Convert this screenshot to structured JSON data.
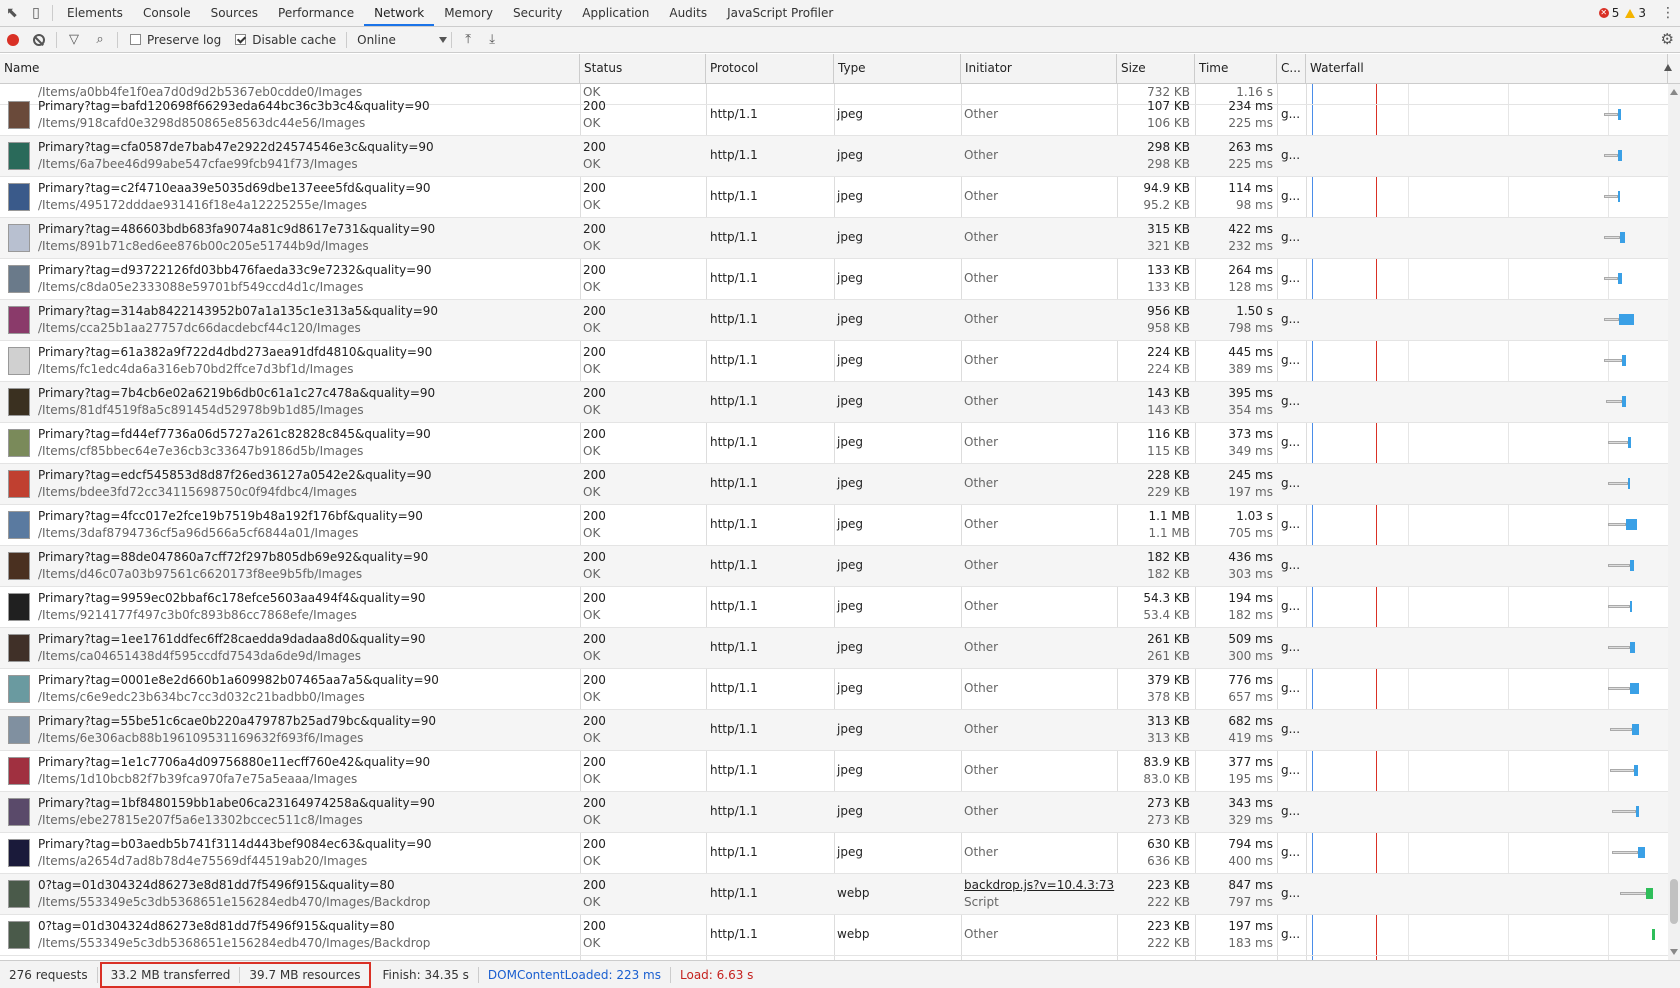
{
  "tabbar": {
    "tabs": [
      "Elements",
      "Console",
      "Sources",
      "Performance",
      "Network",
      "Memory",
      "Security",
      "Application",
      "Audits",
      "JavaScript Profiler"
    ],
    "active": "Network",
    "errors": "5",
    "warnings": "3"
  },
  "toolbar": {
    "preserve_log": "Preserve log",
    "disable_cache": "Disable cache",
    "throttle": "Online"
  },
  "columns": [
    "Name",
    "Status",
    "Protocol",
    "Type",
    "Initiator",
    "Size",
    "Time",
    "C...",
    "Waterfall"
  ],
  "top_partial": {
    "name": "/Items/a0bb4fe1f0ea7d0d9d2b5367eb0cdde0/Images",
    "status": "OK",
    "size": "732 KB",
    "time": "1.16 s"
  },
  "rows": [
    {
      "name": "Primary?tag=bafd120698f66293eda644bc36c3b3c4&quality=90",
      "path": "/Items/918cafd0e3298d850865e8563dc44e56/Images",
      "status": "200",
      "status_text": "OK",
      "protocol": "http/1.1",
      "type": "jpeg",
      "initiator": "Other",
      "size": "107 KB",
      "resource": "106 KB",
      "time": "234 ms",
      "latency": "225 ms",
      "cache": "g...",
      "thumb": "#6a4a3a"
    },
    {
      "name": "Primary?tag=cfa0587de7bab47e2922d24574546e3c&quality=90",
      "path": "/Items/6a7bee46d99abe547cfae99fcb941f73/Images",
      "status": "200",
      "status_text": "OK",
      "protocol": "http/1.1",
      "type": "jpeg",
      "initiator": "Other",
      "size": "298 KB",
      "resource": "298 KB",
      "time": "263 ms",
      "latency": "225 ms",
      "cache": "g...",
      "thumb": "#2a6a5a"
    },
    {
      "name": "Primary?tag=c2f4710eaa39e5035d69dbe137eee5fd&quality=90",
      "path": "/Items/495172dddae931416f18e4a12225255e/Images",
      "status": "200",
      "status_text": "OK",
      "protocol": "http/1.1",
      "type": "jpeg",
      "initiator": "Other",
      "size": "94.9 KB",
      "resource": "95.2 KB",
      "time": "114 ms",
      "latency": "98 ms",
      "cache": "g...",
      "thumb": "#3a5a8a"
    },
    {
      "name": "Primary?tag=486603bdb683fa9074a81c9d8617e731&quality=90",
      "path": "/Items/891b71c8ed6ee876b00c205e51744b9d/Images",
      "status": "200",
      "status_text": "OK",
      "protocol": "http/1.1",
      "type": "jpeg",
      "initiator": "Other",
      "size": "315 KB",
      "resource": "321 KB",
      "time": "422 ms",
      "latency": "232 ms",
      "cache": "g...",
      "thumb": "#b8c0d0"
    },
    {
      "name": "Primary?tag=d93722126fd03bb476faeda33c9e7232&quality=90",
      "path": "/Items/c8da05e2333088e59701bf549ccd4d1c/Images",
      "status": "200",
      "status_text": "OK",
      "protocol": "http/1.1",
      "type": "jpeg",
      "initiator": "Other",
      "size": "133 KB",
      "resource": "133 KB",
      "time": "264 ms",
      "latency": "128 ms",
      "cache": "g...",
      "thumb": "#6a7a8a"
    },
    {
      "name": "Primary?tag=314ab8422143952b07a1a135c1e313a5&quality=90",
      "path": "/Items/cca25b1aa27757dc66dacdebcf44c120/Images",
      "status": "200",
      "status_text": "OK",
      "protocol": "http/1.1",
      "type": "jpeg",
      "initiator": "Other",
      "size": "956 KB",
      "resource": "958 KB",
      "time": "1.50 s",
      "latency": "798 ms",
      "cache": "g...",
      "thumb": "#8a3a6a"
    },
    {
      "name": "Primary?tag=61a382a9f722d4dbd273aea91dfd4810&quality=90",
      "path": "/Items/fc1edc4da6a316eb70bd2ffce7d3bf1d/Images",
      "status": "200",
      "status_text": "OK",
      "protocol": "http/1.1",
      "type": "jpeg",
      "initiator": "Other",
      "size": "224 KB",
      "resource": "224 KB",
      "time": "445 ms",
      "latency": "389 ms",
      "cache": "g...",
      "thumb": "#d0d0d0"
    },
    {
      "name": "Primary?tag=7b4cb6e02a6219b6db0c61a1c27c478a&quality=90",
      "path": "/Items/81df4519f8a5c891454d52978b9b1d85/Images",
      "status": "200",
      "status_text": "OK",
      "protocol": "http/1.1",
      "type": "jpeg",
      "initiator": "Other",
      "size": "143 KB",
      "resource": "143 KB",
      "time": "395 ms",
      "latency": "354 ms",
      "cache": "g...",
      "thumb": "#3a3020"
    },
    {
      "name": "Primary?tag=fd44ef7736a06d5727a261c82828c845&quality=90",
      "path": "/Items/cf85bbec64e7e36cb3c33647b9186d5b/Images",
      "status": "200",
      "status_text": "OK",
      "protocol": "http/1.1",
      "type": "jpeg",
      "initiator": "Other",
      "size": "116 KB",
      "resource": "115 KB",
      "time": "373 ms",
      "latency": "349 ms",
      "cache": "g...",
      "thumb": "#7a8a5a"
    },
    {
      "name": "Primary?tag=edcf545853d8d87f26ed36127a0542e2&quality=90",
      "path": "/Items/bdee3fd72cc34115698750c0f94fdbc4/Images",
      "status": "200",
      "status_text": "OK",
      "protocol": "http/1.1",
      "type": "jpeg",
      "initiator": "Other",
      "size": "228 KB",
      "resource": "229 KB",
      "time": "245 ms",
      "latency": "197 ms",
      "cache": "g...",
      "thumb": "#c04030"
    },
    {
      "name": "Primary?tag=4fcc017e2fce19b7519b48a192f176bf&quality=90",
      "path": "/Items/3daf8794736cf5a96d566a5cf6844a01/Images",
      "status": "200",
      "status_text": "OK",
      "protocol": "http/1.1",
      "type": "jpeg",
      "initiator": "Other",
      "size": "1.1 MB",
      "resource": "1.1 MB",
      "time": "1.03 s",
      "latency": "705 ms",
      "cache": "g...",
      "thumb": "#5a7aa0"
    },
    {
      "name": "Primary?tag=88de047860a7cff72f297b805db69e92&quality=90",
      "path": "/Items/d46c07a03b97561c6620173f8ee9b5fb/Images",
      "status": "200",
      "status_text": "OK",
      "protocol": "http/1.1",
      "type": "jpeg",
      "initiator": "Other",
      "size": "182 KB",
      "resource": "182 KB",
      "time": "436 ms",
      "latency": "303 ms",
      "cache": "g...",
      "thumb": "#4a3020"
    },
    {
      "name": "Primary?tag=9959ec02bbaf6c178efce5603aa494f4&quality=90",
      "path": "/Items/9214177f497c3b0fc893b86cc7868efe/Images",
      "status": "200",
      "status_text": "OK",
      "protocol": "http/1.1",
      "type": "jpeg",
      "initiator": "Other",
      "size": "54.3 KB",
      "resource": "53.4 KB",
      "time": "194 ms",
      "latency": "182 ms",
      "cache": "g...",
      "thumb": "#202020"
    },
    {
      "name": "Primary?tag=1ee1761ddfec6ff28caedda9dadaa8d0&quality=90",
      "path": "/Items/ca04651438d4f595ccdfd7543da6de9d/Images",
      "status": "200",
      "status_text": "OK",
      "protocol": "http/1.1",
      "type": "jpeg",
      "initiator": "Other",
      "size": "261 KB",
      "resource": "261 KB",
      "time": "509 ms",
      "latency": "300 ms",
      "cache": "g...",
      "thumb": "#403028"
    },
    {
      "name": "Primary?tag=0001e8e2d660b1a609982b07465aa7a5&quality=90",
      "path": "/Items/c6e9edc23b634bc7cc3d032c21badbb0/Images",
      "status": "200",
      "status_text": "OK",
      "protocol": "http/1.1",
      "type": "jpeg",
      "initiator": "Other",
      "size": "379 KB",
      "resource": "378 KB",
      "time": "776 ms",
      "latency": "657 ms",
      "cache": "g...",
      "thumb": "#6a9aa0"
    },
    {
      "name": "Primary?tag=55be51c6cae0b220a479787b25ad79bc&quality=90",
      "path": "/Items/6e306acb88b196109531169632f693f6/Images",
      "status": "200",
      "status_text": "OK",
      "protocol": "http/1.1",
      "type": "jpeg",
      "initiator": "Other",
      "size": "313 KB",
      "resource": "313 KB",
      "time": "682 ms",
      "latency": "419 ms",
      "cache": "g...",
      "thumb": "#8090a0"
    },
    {
      "name": "Primary?tag=1e1c7706a4d09756880e11ecff760e42&quality=90",
      "path": "/Items/1d10bcb82f7b39fca970fa7e75a5eaaa/Images",
      "status": "200",
      "status_text": "OK",
      "protocol": "http/1.1",
      "type": "jpeg",
      "initiator": "Other",
      "size": "83.9 KB",
      "resource": "83.0 KB",
      "time": "377 ms",
      "latency": "195 ms",
      "cache": "g...",
      "thumb": "#a03040"
    },
    {
      "name": "Primary?tag=1bf8480159bb1abe06ca23164974258a&quality=90",
      "path": "/Items/ebe27815e207f5a6e13302bccec511c8/Images",
      "status": "200",
      "status_text": "OK",
      "protocol": "http/1.1",
      "type": "jpeg",
      "initiator": "Other",
      "size": "273 KB",
      "resource": "273 KB",
      "time": "343 ms",
      "latency": "329 ms",
      "cache": "g...",
      "thumb": "#5a4a6a"
    },
    {
      "name": "Primary?tag=b03aedb5b741f3114d443bef9084ec63&quality=90",
      "path": "/Items/a2654d7ad8b78d4e75569df44519ab20/Images",
      "status": "200",
      "status_text": "OK",
      "protocol": "http/1.1",
      "type": "jpeg",
      "initiator": "Other",
      "size": "630 KB",
      "resource": "636 KB",
      "time": "794 ms",
      "latency": "400 ms",
      "cache": "g...",
      "thumb": "#1a1a3a"
    },
    {
      "name": "0?tag=01d304324d86273e8d81dd7f5496f915&quality=80",
      "path": "/Items/553349e5c3db5368651e156284edb470/Images/Backdrop",
      "status": "200",
      "status_text": "OK",
      "protocol": "http/1.1",
      "type": "webp",
      "initiator": "backdrop.js?v=10.4.3:73",
      "initiator_sub": "Script",
      "size": "223 KB",
      "resource": "222 KB",
      "time": "847 ms",
      "latency": "797 ms",
      "cache": "g...",
      "thumb": "#4a5a4a"
    },
    {
      "name": "0?tag=01d304324d86273e8d81dd7f5496f915&quality=80",
      "path": "/Items/553349e5c3db5368651e156284edb470/Images/Backdrop",
      "status": "200",
      "status_text": "OK",
      "protocol": "http/1.1",
      "type": "webp",
      "initiator": "Other",
      "size": "223 KB",
      "resource": "222 KB",
      "time": "197 ms",
      "latency": "183 ms",
      "cache": "g...",
      "thumb": "#4a5a4a"
    }
  ],
  "statusbar": {
    "requests": "276 requests",
    "transferred": "33.2 MB transferred",
    "resources": "39.7 MB resources",
    "finish": "Finish: 34.35 s",
    "dcl": "DOMContentLoaded: 223 ms",
    "load": "Load: 6.63 s"
  }
}
